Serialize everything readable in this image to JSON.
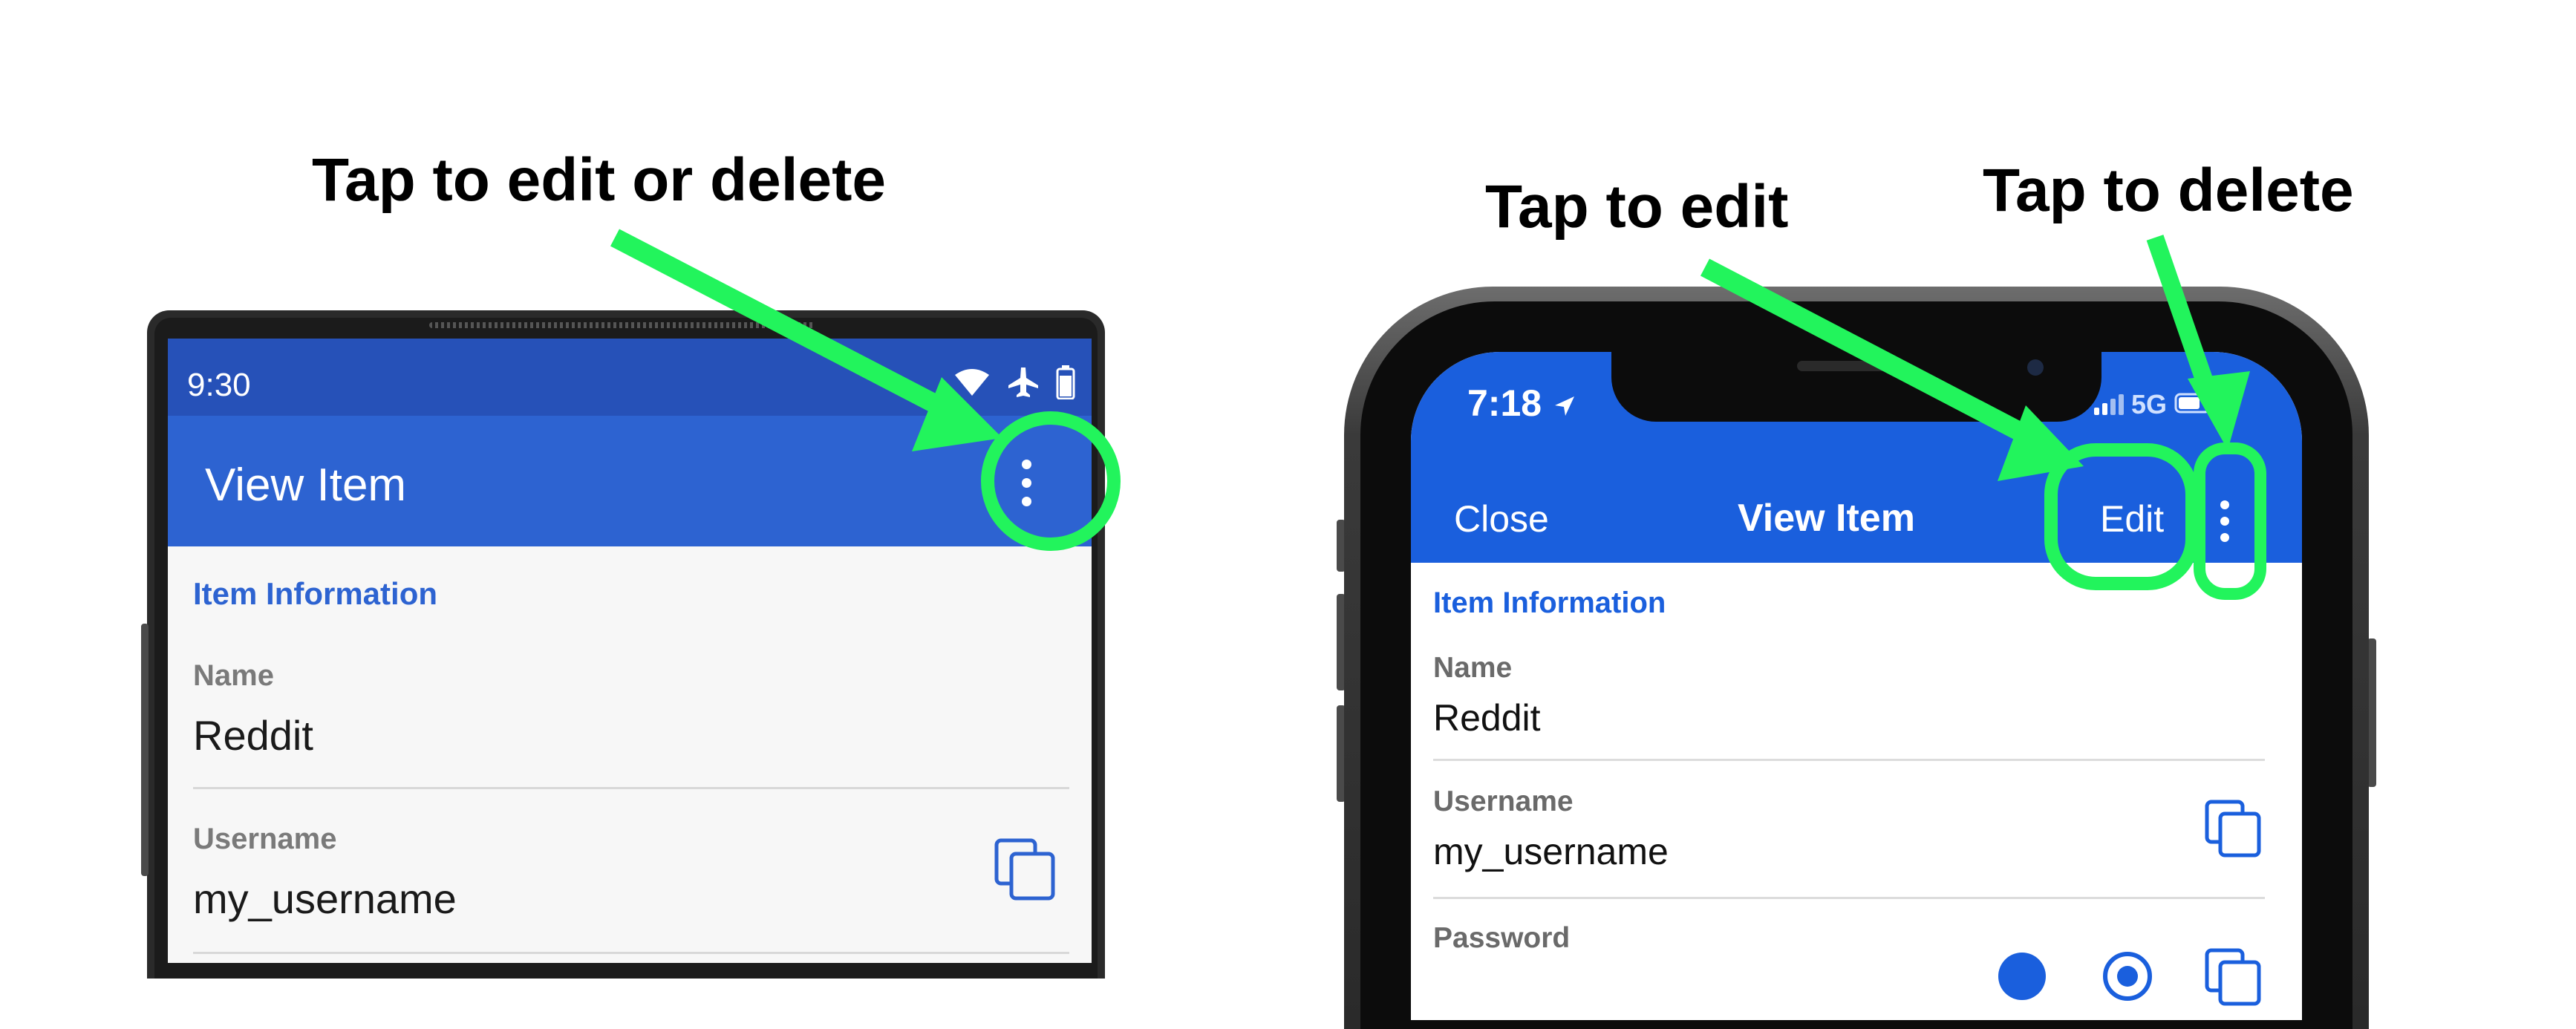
{
  "callouts": {
    "left": "Tap to edit or delete",
    "edit": "Tap to edit",
    "delete": "Tap to delete"
  },
  "android": {
    "status_time": "9:30",
    "app_title": "View Item",
    "section_title": "Item Information",
    "fields": [
      {
        "label": "Name",
        "value": "Reddit"
      },
      {
        "label": "Username",
        "value": "my_username"
      }
    ],
    "icons": [
      "wifi-icon",
      "airplane-icon",
      "battery-icon",
      "more-vert-icon",
      "copy-icon"
    ]
  },
  "ios": {
    "status_time": "7:18",
    "network": "5G",
    "close_label": "Close",
    "title": "View Item",
    "edit_label": "Edit",
    "section_title": "Item Information",
    "fields": [
      {
        "label": "Name",
        "value": "Reddit"
      },
      {
        "label": "Username",
        "value": "my_username"
      },
      {
        "label": "Password",
        "value": ""
      }
    ],
    "icons": [
      "location-arrow-icon",
      "signal-icon",
      "battery-icon",
      "more-vert-icon",
      "copy-icon",
      "eye-icon",
      "refresh-icon"
    ]
  },
  "colors": {
    "highlight": "#22f45c",
    "android_status": "#2651b8",
    "android_appbar": "#2d63d1",
    "ios_header": "#1a5fdd"
  }
}
